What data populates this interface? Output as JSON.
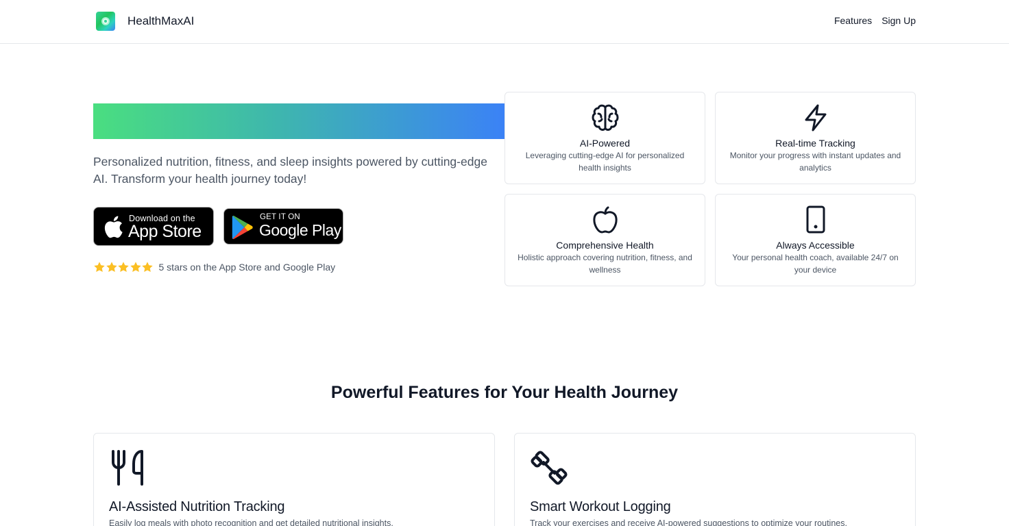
{
  "header": {
    "brand": "HealthMaxAI",
    "nav": [
      {
        "label": "Features"
      },
      {
        "label": "Sign Up"
      }
    ]
  },
  "hero": {
    "subtitle": "Personalized nutrition, fitness, and sleep insights powered by cutting-edge AI. Transform your health journey today!",
    "app_store": {
      "small": "Download on the",
      "big": "App Store"
    },
    "google_play": {
      "small": "GET IT ON",
      "big": "Google Play"
    },
    "rating": {
      "stars": 5,
      "text": "5 stars on the App Store and Google Play"
    },
    "cards": [
      {
        "icon": "brain-icon",
        "title": "AI-Powered",
        "desc": "Leveraging cutting-edge AI for personalized health insights"
      },
      {
        "icon": "lightning-icon",
        "title": "Real-time Tracking",
        "desc": "Monitor your progress with instant updates and analytics"
      },
      {
        "icon": "apple-fruit-icon",
        "title": "Comprehensive Health",
        "desc": "Holistic approach covering nutrition, fitness, and wellness"
      },
      {
        "icon": "tablet-icon",
        "title": "Always Accessible",
        "desc": "Your personal health coach, available 24/7 on your device"
      }
    ]
  },
  "features": {
    "title": "Powerful Features for Your Health Journey",
    "items": [
      {
        "icon": "utensils-icon",
        "title": "AI-Assisted Nutrition Tracking",
        "desc": "Easily log meals with photo recognition and get detailed nutritional insights."
      },
      {
        "icon": "dumbbell-icon",
        "title": "Smart Workout Logging",
        "desc": "Track your exercises and receive AI-powered suggestions to optimize your routines."
      }
    ]
  },
  "colors": {
    "gradient_start": "#4ade80",
    "gradient_end": "#3b82f6",
    "star": "#fbbf24",
    "text_muted": "#4b5563",
    "border": "#e5e7eb"
  }
}
